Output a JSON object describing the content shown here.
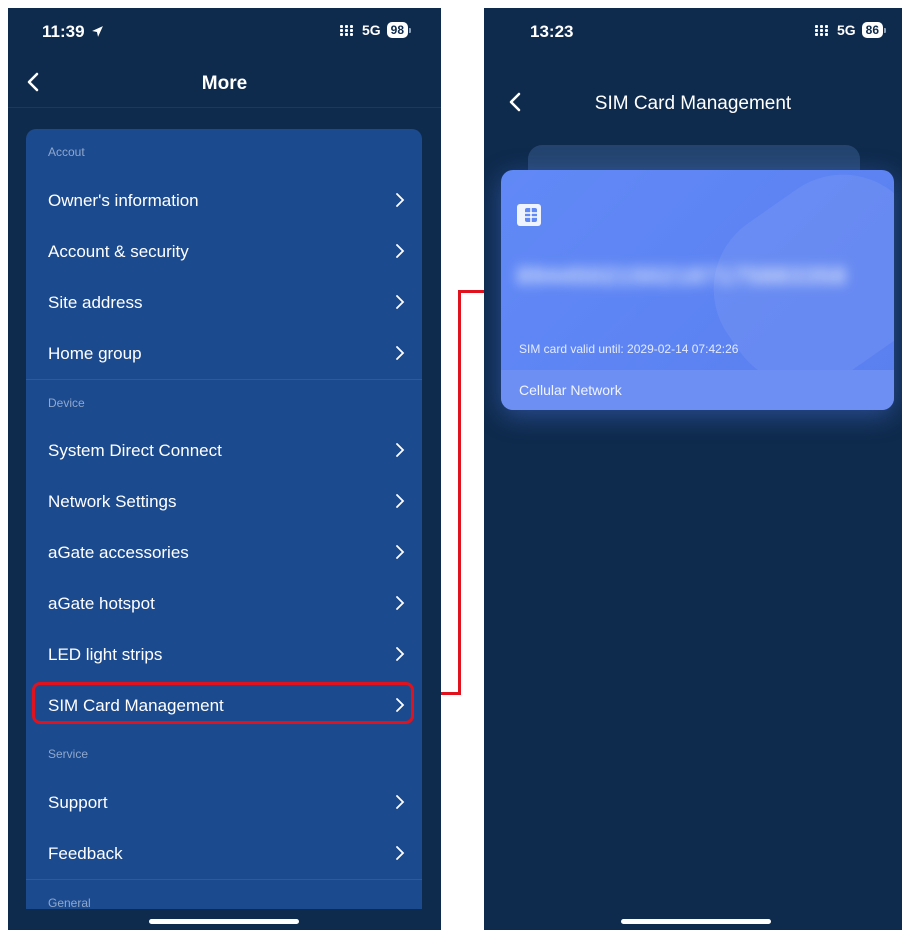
{
  "left_phone": {
    "status": {
      "time": "11:39",
      "network": "5G",
      "battery": "98"
    },
    "title": "More",
    "sections": [
      {
        "header": "Accout",
        "items": [
          "Owner's information",
          "Account & security",
          "Site address",
          "Home group"
        ]
      },
      {
        "header": "Device",
        "items": [
          "System Direct Connect",
          "Network Settings",
          "aGate accessories",
          "aGate hotspot",
          "LED light strips",
          "SIM Card Management"
        ]
      },
      {
        "header": "Service",
        "items": [
          "Support",
          "Feedback"
        ]
      },
      {
        "header": "General",
        "items": []
      }
    ]
  },
  "right_phone": {
    "status": {
      "time": "13:23",
      "network": "5G",
      "battery": "86"
    },
    "title": "SIM Card Management",
    "sim_card": {
      "number_blurred": "89445021502187175883358",
      "valid_until": "SIM card valid until: 2029-02-14 07:42:26",
      "footer": "Cellular Network"
    }
  },
  "colors": {
    "background": "#0e2a4c",
    "menu_card": "#1c4a8e",
    "highlight": "#e0121e",
    "sim_card": "#6189f6"
  },
  "icons": [
    "back-chevron-icon",
    "chevron-right-icon",
    "location-arrow-icon",
    "signal-icon",
    "battery-icon",
    "sim-chip-icon"
  ]
}
